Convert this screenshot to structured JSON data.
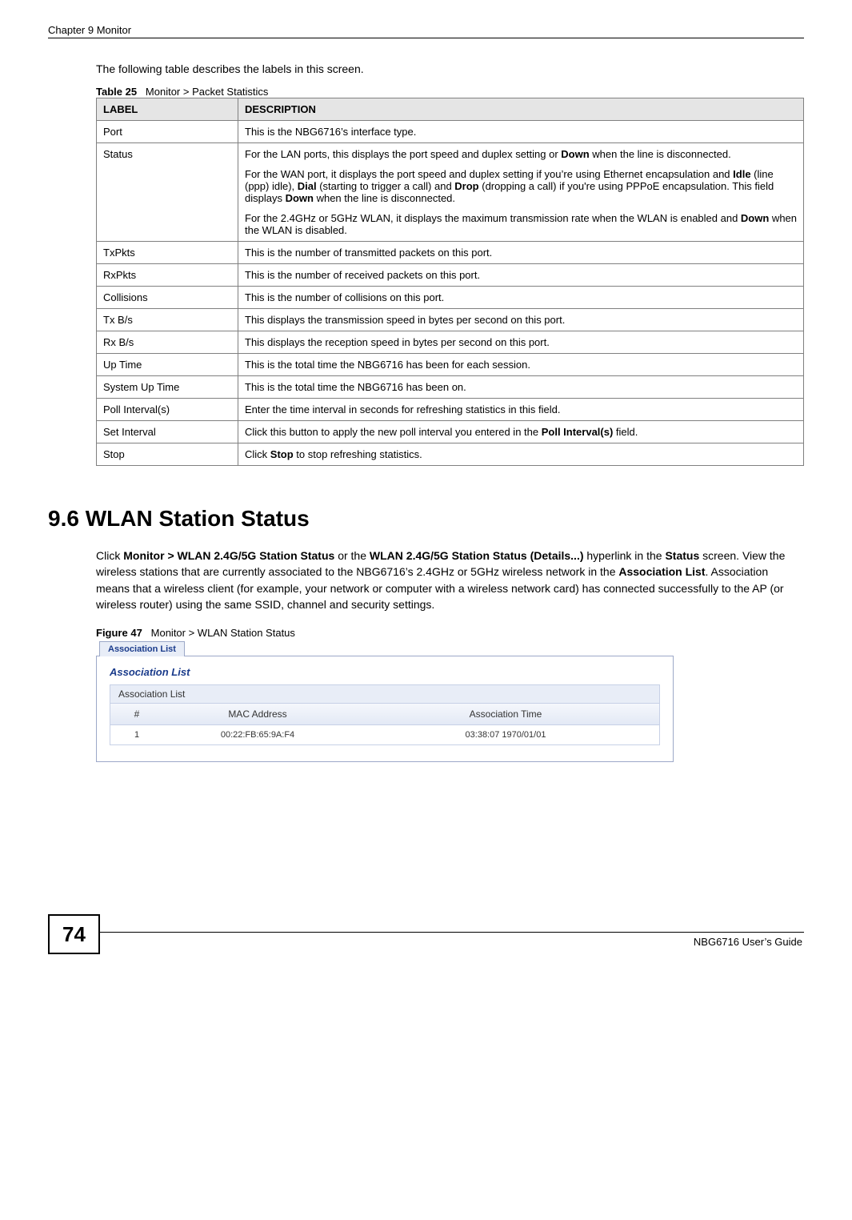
{
  "header": {
    "chapter": "Chapter 9 Monitor"
  },
  "intro": "The following table describes the labels in this screen.",
  "table25": {
    "caption_prefix": "Table 25",
    "caption_text": "Monitor > Packet Statistics",
    "head_label": "LABEL",
    "head_desc": "DESCRIPTION",
    "rows": [
      {
        "label": "Port",
        "desc_html": "This is the NBG6716’s interface type."
      },
      {
        "label": "Status",
        "desc_html": "<p>For the LAN ports, this displays the port speed and duplex setting or <b>Down</b> when the line is disconnected.</p><p>For the WAN port, it displays the port speed and duplex setting if you’re using Ethernet encapsulation and <b>Idle</b> (line (ppp) idle), <b>Dial</b> (starting to trigger a call) and <b>Drop</b> (dropping a call) if you're using PPPoE encapsulation. This field displays <b>Down</b> when the line is disconnected.</p><p>For the 2.4GHz or 5GHz WLAN, it displays the maximum transmission rate when the WLAN is enabled and <b>Down</b> when the WLAN is disabled.</p>"
      },
      {
        "label": "TxPkts",
        "desc_html": "This is the number of transmitted packets on this port."
      },
      {
        "label": "RxPkts",
        "desc_html": "This is the number of received packets on this port."
      },
      {
        "label": "Collisions",
        "desc_html": "This is the number of collisions on this port."
      },
      {
        "label": "Tx B/s",
        "desc_html": "This displays the transmission speed in bytes per second on this port."
      },
      {
        "label": "Rx B/s",
        "desc_html": "This displays the reception speed in bytes per second on this port."
      },
      {
        "label": "Up Time",
        "desc_html": "This is the total time the NBG6716 has been for each session."
      },
      {
        "label": "System Up Time",
        "desc_html": "This is the total time the NBG6716 has been on."
      },
      {
        "label": "Poll Interval(s)",
        "desc_html": "Enter the time interval in seconds for refreshing statistics in this field."
      },
      {
        "label": "Set Interval",
        "desc_html": "Click this button to apply the new poll interval you entered in the <b>Poll Interval(s)</b> field."
      },
      {
        "label": "Stop",
        "desc_html": "Click <b>Stop</b> to stop refreshing statistics."
      }
    ]
  },
  "section96": {
    "heading": "9.6  WLAN Station Status",
    "body_html": "Click <b>Monitor &gt; WLAN 2.4G/5G Station Status</b> or the <b>WLAN 2.4G/5G Station Status (Details...)</b> hyperlink in the <b>Status</b> screen. View the wireless stations that are currently associated to the NBG6716’s 2.4GHz or 5GHz wireless network in the <b>Association List</b>. Association means that a wireless client (for example, your network or computer with a wireless network card) has connected successfully to the AP (or wireless router) using the same SSID, channel and security settings."
  },
  "figure47": {
    "caption_prefix": "Figure 47",
    "caption_text": "Monitor > WLAN Station Status",
    "tab_label": "Association List",
    "panel_title": "Association List",
    "box_header": "Association List",
    "columns": {
      "num": "#",
      "mac": "MAC Address",
      "time": "Association Time"
    },
    "rows": [
      {
        "num": "1",
        "mac": "00:22:FB:65:9A:F4",
        "time": "03:38:07 1970/01/01"
      }
    ]
  },
  "footer": {
    "page_number": "74",
    "guide": "NBG6716 User’s Guide"
  }
}
